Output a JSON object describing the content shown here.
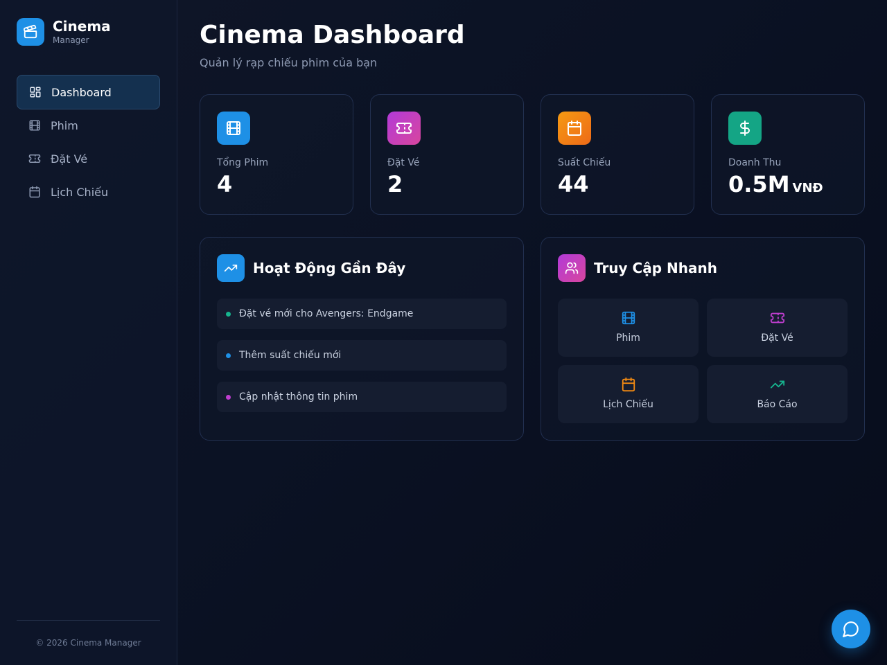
{
  "brand": {
    "title": "Cinema",
    "subtitle": "Manager",
    "logo_icon": "clapperboard-icon"
  },
  "sidebar": {
    "items": [
      {
        "label": "Dashboard",
        "icon": "dashboard-grid-icon",
        "active": true
      },
      {
        "label": "Phim",
        "icon": "film-icon",
        "active": false
      },
      {
        "label": "Đặt Vé",
        "icon": "ticket-icon",
        "active": false
      },
      {
        "label": "Lịch Chiếu",
        "icon": "calendar-icon",
        "active": false
      }
    ],
    "footer": "© 2026 Cinema Manager"
  },
  "header": {
    "title": "Cinema Dashboard",
    "subtitle": "Quản lý rạp chiếu phim của bạn"
  },
  "stats": [
    {
      "label": "Tổng Phim",
      "value": "4",
      "unit": "",
      "icon": "film-icon",
      "color": "#1e90e6"
    },
    {
      "label": "Đặt Vé",
      "value": "2",
      "unit": "",
      "icon": "ticket-icon",
      "color": "#c03ed0"
    },
    {
      "label": "Suất Chiếu",
      "value": "44",
      "unit": "",
      "icon": "calendar-icon",
      "color": "#f28a12"
    },
    {
      "label": "Doanh Thu",
      "value": "0.5M",
      "unit": "VNĐ",
      "icon": "dollar-icon",
      "color": "#14a585"
    }
  ],
  "activity": {
    "title": "Hoạt Động Gần Đây",
    "icon": "trending-up-icon",
    "items": [
      {
        "text": "Đặt vé mới cho Avengers: Endgame",
        "dot_color": "#16b58e"
      },
      {
        "text": "Thêm suất chiếu mới",
        "dot_color": "#1e90e6"
      },
      {
        "text": "Cập nhật thông tin phim",
        "dot_color": "#c03ed0"
      }
    ]
  },
  "quick_access": {
    "title": "Truy Cập Nhanh",
    "icon": "users-icon",
    "items": [
      {
        "label": "Phim",
        "icon": "film-icon",
        "color": "#1e90e6"
      },
      {
        "label": "Đặt Vé",
        "icon": "ticket-icon",
        "color": "#c03ed0"
      },
      {
        "label": "Lịch Chiếu",
        "icon": "calendar-icon",
        "color": "#f28a12"
      },
      {
        "label": "Báo Cáo",
        "icon": "trending-up-icon",
        "color": "#16b58e"
      }
    ]
  },
  "chat_button": {
    "icon": "chat-bubble-icon"
  },
  "colors": {
    "accent": "#1e90e6",
    "background": "#0b1224",
    "active_nav": "#14304f"
  }
}
